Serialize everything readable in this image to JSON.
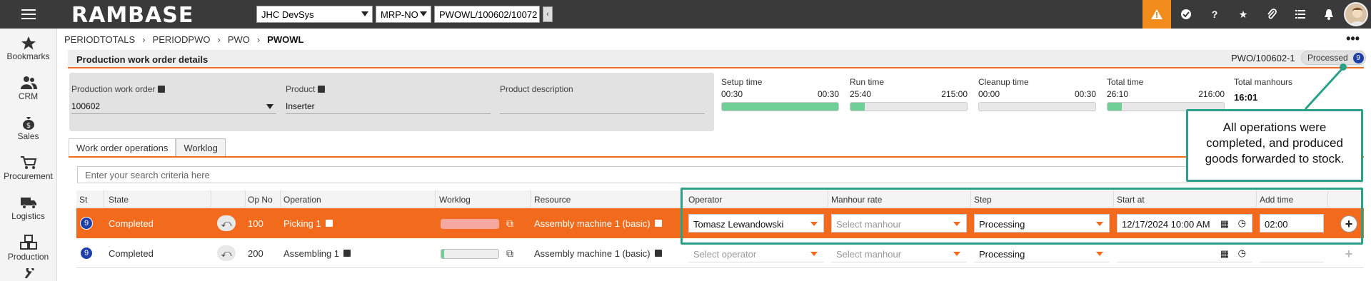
{
  "topbar": {
    "logo": "RAMBASE",
    "company": "JHC DevSys",
    "locale": "MRP-NO",
    "path": "PWOWL/100602/10072",
    "back_glyph": "‹",
    "icons": [
      "warning-icon",
      "check-badge-icon",
      "help-icon",
      "star-icon",
      "paperclip-icon",
      "list-icon",
      "bell-icon"
    ]
  },
  "sidebar": {
    "items": [
      {
        "label": "Bookmarks",
        "icon": "star-icon"
      },
      {
        "label": "CRM",
        "icon": "people-icon"
      },
      {
        "label": "Sales",
        "icon": "money-bag-icon"
      },
      {
        "label": "Procurement",
        "icon": "cart-icon"
      },
      {
        "label": "Logistics",
        "icon": "truck-icon"
      },
      {
        "label": "Production",
        "icon": "boxes-icon"
      }
    ]
  },
  "breadcrumb": [
    "PERIODTOTALS",
    "PERIODPWO",
    "PWO",
    "PWOWL"
  ],
  "header": {
    "title": "Production work order details",
    "wo_id": "PWO/100602-1",
    "status": "Processed",
    "status_count": "9"
  },
  "info": {
    "pwo_label": "Production work order",
    "pwo_value": "100602",
    "product_label": "Product",
    "product_value": "Inserter",
    "desc_label": "Product description",
    "desc_value": ""
  },
  "times": [
    {
      "label": "Setup time",
      "value": "00:30",
      "max": "00:30",
      "fill": 1.0
    },
    {
      "label": "Run time",
      "value": "25:40",
      "max": "215:00",
      "fill": 0.12
    },
    {
      "label": "Cleanup time",
      "value": "00:00",
      "max": "00:30",
      "fill": 0.0
    },
    {
      "label": "Total time",
      "value": "26:10",
      "max": "216:00",
      "fill": 0.12
    }
  ],
  "manhours": {
    "label": "Total manhours",
    "value": "16:01"
  },
  "tabs": [
    "Work order operations",
    "Worklog"
  ],
  "search": {
    "placeholder": "Enter your search criteria here"
  },
  "columns": [
    "St",
    "State",
    "Op No",
    "Operation",
    "Worklog",
    "Resource",
    "Operator",
    "Manhour rate",
    "Step",
    "Start at",
    "Add time"
  ],
  "rows": [
    {
      "st": "9",
      "state": "Completed",
      "op_no": "100",
      "operation": "Picking 1",
      "worklog_fill": 1.0,
      "resource": "Assembly machine 1 (basic)",
      "operator": "Tomasz Lewandowski",
      "manhour": "Select manhour",
      "step": "Processing",
      "start": "12/17/2024 10:00 AM",
      "add_time": "02:00"
    },
    {
      "st": "9",
      "state": "Completed",
      "op_no": "200",
      "operation": "Assembling 1",
      "worklog_fill": 0.05,
      "resource": "Assembly machine 1 (basic)",
      "operator": "Select operator",
      "manhour": "Select manhour",
      "step": "Processing",
      "start": "",
      "add_time": ""
    }
  ],
  "callout": {
    "text": "All operations were completed, and produced goods forwarded to stock."
  },
  "colors": {
    "accent": "#f26b1d",
    "highlight": "#2da08a",
    "progress": "#6fcf97",
    "topbar": "#3a3a3a"
  }
}
